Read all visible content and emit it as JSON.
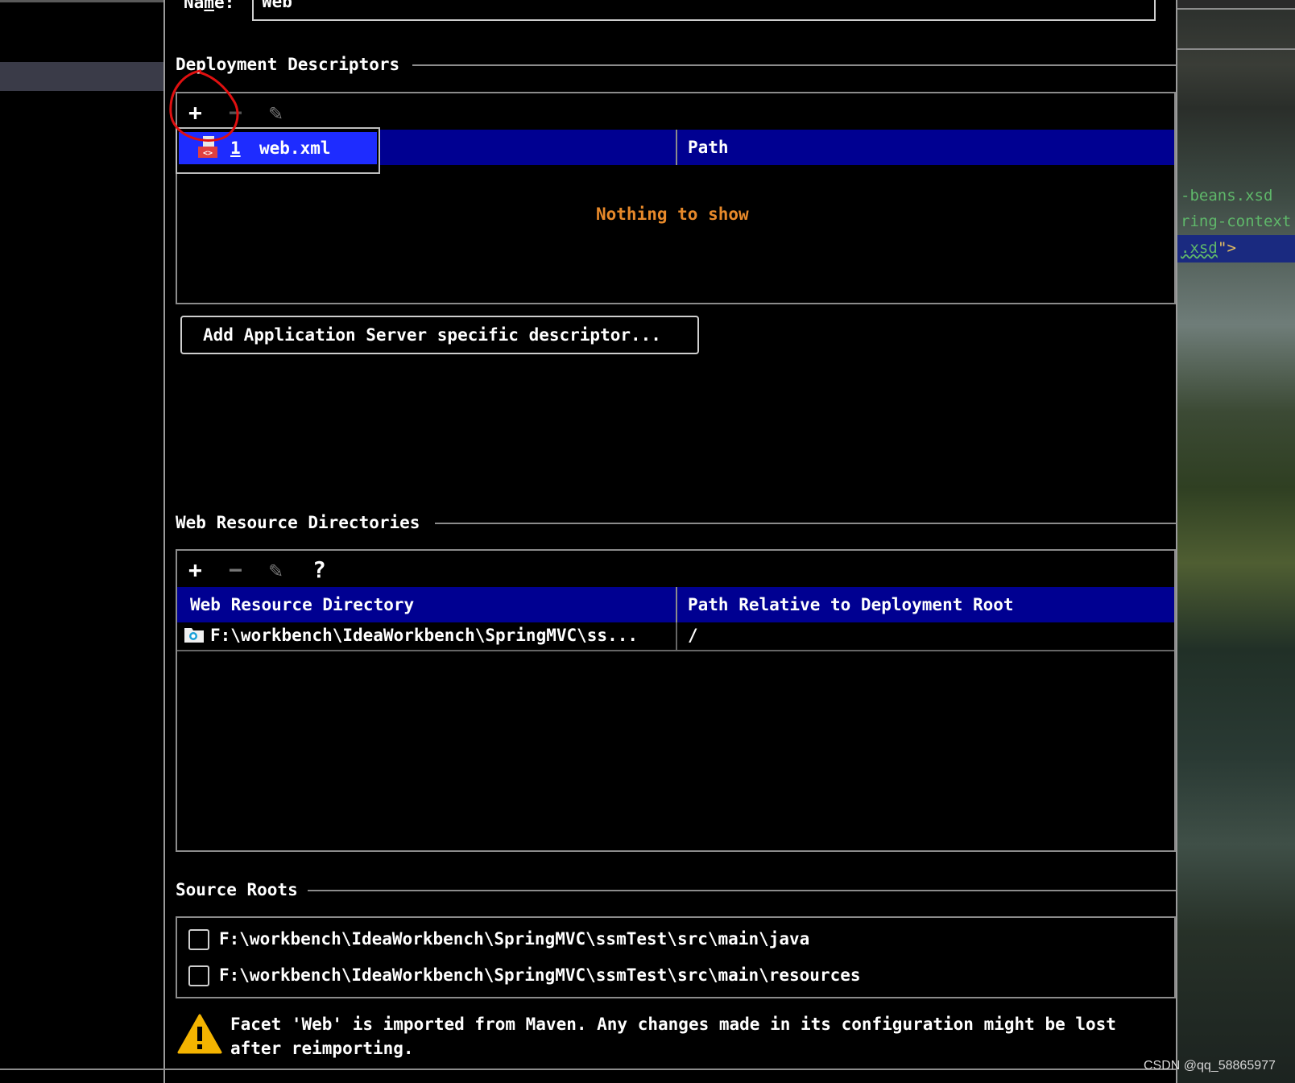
{
  "name_field": {
    "label": "Name:",
    "value": "Web"
  },
  "deployment": {
    "title": "Deployment Descriptors",
    "toolbar": {
      "add": "+",
      "remove": "−",
      "edit": "✎"
    },
    "columns": [
      "",
      "Path"
    ],
    "empty_text": "Nothing to show",
    "popup_item": {
      "index": "1",
      "label": "web.xml"
    },
    "add_server_button": "Add Application Server specific descriptor..."
  },
  "web_resources": {
    "title": "Web Resource Directories",
    "toolbar": {
      "add": "+",
      "remove": "−",
      "edit": "✎",
      "help": "?"
    },
    "columns": [
      "Web Resource Directory",
      "Path Relative to Deployment Root"
    ],
    "rows": [
      {
        "directory": "F:\\workbench\\IdeaWorkbench\\SpringMVC\\ss...",
        "path": "/"
      }
    ]
  },
  "source_roots": {
    "title": "Source Roots",
    "items": [
      {
        "path": "F:\\workbench\\IdeaWorkbench\\SpringMVC\\ssmTest\\src\\main\\java",
        "checked": false
      },
      {
        "path": "F:\\workbench\\IdeaWorkbench\\SpringMVC\\ssmTest\\src\\main\\resources",
        "checked": false
      }
    ]
  },
  "warning": {
    "line1": "Facet 'Web' is imported from Maven. Any changes made in its configuration might be lost",
    "line2": "after reimporting."
  },
  "editor_snippets": [
    "-beans.xsd",
    "ring-context",
    ".xsd",
    "\">"
  ],
  "watermark": "CSDN @qq_58865977",
  "colors": {
    "header_blue": "#000091",
    "selection_blue": "#1e2cff",
    "empty_text": "#e7892a",
    "annotation_red": "#e01010",
    "code_green": "#5fb86a",
    "warning_yellow": "#f4b400"
  }
}
